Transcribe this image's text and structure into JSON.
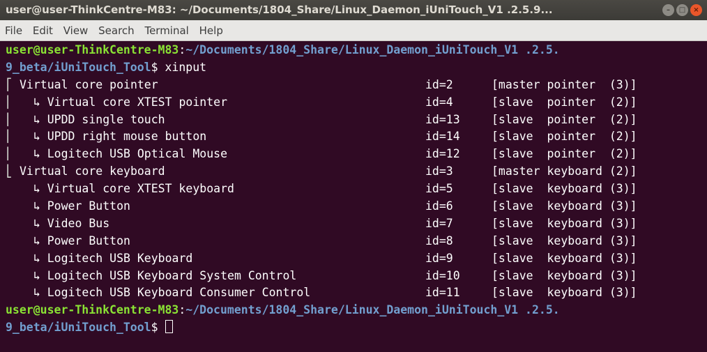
{
  "window": {
    "title": "user@user-ThinkCentre-M83: ~/Documents/1804_Share/Linux_Daemon_iUniTouch_V1 .2.5.9...",
    "minimize_glyph": "–",
    "maximize_glyph": "□",
    "close_glyph": "×"
  },
  "menu": [
    "File",
    "Edit",
    "View",
    "Search",
    "Terminal",
    "Help"
  ],
  "prompt": {
    "user": "user@user-ThinkCentre-M83",
    "sep": ":",
    "path_line1": "~/Documents/1804_Share/Linux_Daemon_iUniTouch_V1 .2.5.",
    "path_line2": "9_beta/iUniTouch_Tool",
    "symbol": "$ ",
    "command": "xinput"
  },
  "devices": [
    {
      "tree": "⎡",
      "name": "Virtual core pointer",
      "id": "id=2",
      "role": "[master pointer  (3)]"
    },
    {
      "tree": "⎜",
      "name": "  ↳ Virtual core XTEST pointer",
      "id": "id=4",
      "role": "[slave  pointer  (2)]"
    },
    {
      "tree": "⎜",
      "name": "  ↳ UPDD single touch",
      "id": "id=13",
      "role": "[slave  pointer  (2)]"
    },
    {
      "tree": "⎜",
      "name": "  ↳ UPDD right mouse button",
      "id": "id=14",
      "role": "[slave  pointer  (2)]"
    },
    {
      "tree": "⎜",
      "name": "  ↳ Logitech USB Optical Mouse",
      "id": "id=12",
      "role": "[slave  pointer  (2)]"
    },
    {
      "tree": "⎣",
      "name": "Virtual core keyboard",
      "id": "id=3",
      "role": "[master keyboard (2)]"
    },
    {
      "tree": " ",
      "name": "  ↳ Virtual core XTEST keyboard",
      "id": "id=5",
      "role": "[slave  keyboard (3)]"
    },
    {
      "tree": " ",
      "name": "  ↳ Power Button",
      "id": "id=6",
      "role": "[slave  keyboard (3)]"
    },
    {
      "tree": " ",
      "name": "  ↳ Video Bus",
      "id": "id=7",
      "role": "[slave  keyboard (3)]"
    },
    {
      "tree": " ",
      "name": "  ↳ Power Button",
      "id": "id=8",
      "role": "[slave  keyboard (3)]"
    },
    {
      "tree": " ",
      "name": "  ↳ Logitech USB Keyboard",
      "id": "id=9",
      "role": "[slave  keyboard (3)]"
    },
    {
      "tree": " ",
      "name": "  ↳ Logitech USB Keyboard System Control",
      "id": "id=10",
      "role": "[slave  keyboard (3)]"
    },
    {
      "tree": " ",
      "name": "  ↳ Logitech USB Keyboard Consumer Control",
      "id": "id=11",
      "role": "[slave  keyboard (3)]"
    }
  ],
  "colors": {
    "terminal_bg": "#300a24",
    "user": "#8ae234",
    "path": "#729fcf",
    "close_button": "#e9562a"
  }
}
